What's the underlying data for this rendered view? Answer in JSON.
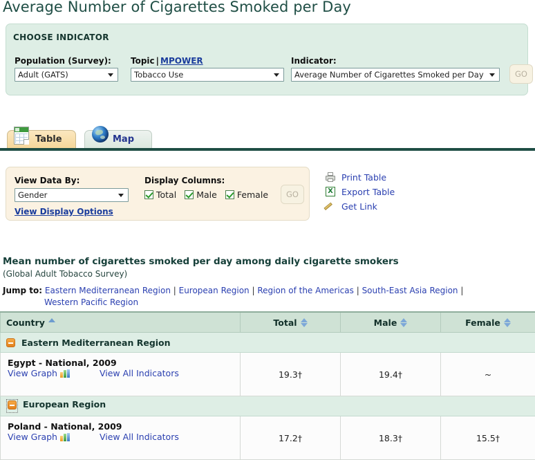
{
  "page_title": "Average Number of Cigarettes Smoked per Day",
  "indicator_panel": {
    "heading": "CHOOSE INDICATOR",
    "population_label": "Population (Survey):",
    "population_value": "Adult (GATS)",
    "topic_label": "Topic",
    "topic_separator": "|",
    "mpower_link": "MPOWER",
    "topic_value": "Tobacco Use",
    "indicator_label": "Indicator:",
    "indicator_value": "Average Number of Cigarettes Smoked per Day",
    "go_label": "GO"
  },
  "tabs": [
    {
      "label": "Table",
      "icon": "spreadsheet-icon",
      "active": true
    },
    {
      "label": "Map",
      "icon": "globe-icon",
      "active": false
    }
  ],
  "view_panel": {
    "view_data_by_label": "View Data By:",
    "view_data_by_value": "Gender",
    "display_columns_label": "Display Columns:",
    "columns": [
      {
        "label": "Total",
        "checked": true
      },
      {
        "label": "Male",
        "checked": true
      },
      {
        "label": "Female",
        "checked": true
      }
    ],
    "go_label": "GO",
    "display_options_link": "View Display Options"
  },
  "actions": [
    {
      "label": "Print Table",
      "icon": "printer-icon"
    },
    {
      "label": "Export Table",
      "icon": "excel-icon"
    },
    {
      "label": "Get Link",
      "icon": "link-icon"
    }
  ],
  "table_section": {
    "title": "Mean number of cigarettes smoked per day among daily cigarette smokers",
    "subtitle": "(Global Adult Tobacco Survey)",
    "jump_label": "Jump to:",
    "jump_links": [
      "Eastern Mediterranean Region",
      "European Region",
      "Region of the Americas",
      "South-East Asia Region",
      "Western Pacific Region"
    ]
  },
  "table": {
    "headers": [
      {
        "label": "Country",
        "sort": "asc"
      },
      {
        "label": "Total",
        "sort": "none"
      },
      {
        "label": "Male",
        "sort": "none"
      },
      {
        "label": "Female",
        "sort": "none"
      }
    ],
    "rows": [
      {
        "type": "region",
        "name": "Eastern Mediterranean Region"
      },
      {
        "type": "data",
        "country": "Egypt - National, 2009",
        "view_graph": "View Graph",
        "view_all": "View All Indicators",
        "total": "19.3†",
        "male": "19.4†",
        "female": "~"
      },
      {
        "type": "region",
        "name": "European Region"
      },
      {
        "type": "data",
        "country": "Poland - National, 2009",
        "view_graph": "View Graph",
        "view_all": "View All Indicators",
        "total": "17.2†",
        "male": "18.3†",
        "female": "15.5†"
      }
    ]
  },
  "colors": {
    "title_green": "#1f4e45",
    "panel_green": "#deeee5",
    "panel_cream": "#fbf2e2",
    "link_blue": "#2a3fb0",
    "accent_orange": "#e2801d",
    "header_green": "#cfe2d5"
  }
}
